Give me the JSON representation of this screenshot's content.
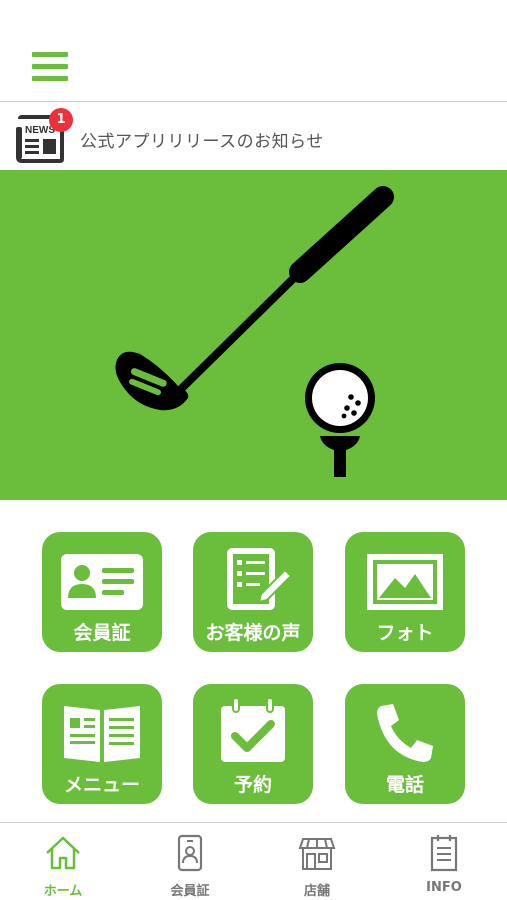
{
  "header": {
    "menu_icon": "hamburger-menu-icon",
    "accent": "#6bbd3c"
  },
  "news": {
    "icon": "newspaper-icon",
    "icon_text": "NEWS",
    "badge_count": "1",
    "text": "公式アプリリリースのお知らせ"
  },
  "banner": {
    "icons": [
      "golf-club-icon",
      "golf-ball-on-tee-icon"
    ],
    "background": "#6bbd3c"
  },
  "tiles": [
    {
      "label": "会員証",
      "icon": "member-card-icon"
    },
    {
      "label": "お客様の声",
      "icon": "feedback-form-icon"
    },
    {
      "label": "フォト",
      "icon": "photo-icon"
    },
    {
      "label": "メニュー",
      "icon": "menu-book-icon"
    },
    {
      "label": "予約",
      "icon": "calendar-check-icon"
    },
    {
      "label": "電話",
      "icon": "phone-icon"
    }
  ],
  "tabbar": {
    "tabs": [
      {
        "label": "ホーム",
        "icon": "home-icon",
        "active": true
      },
      {
        "label": "会員証",
        "icon": "member-card-icon"
      },
      {
        "label": "店舗",
        "icon": "store-icon"
      },
      {
        "label": "INFO",
        "icon": "info-document-icon"
      }
    ],
    "active_color": "#6bbd3c",
    "inactive_color": "#777777"
  }
}
